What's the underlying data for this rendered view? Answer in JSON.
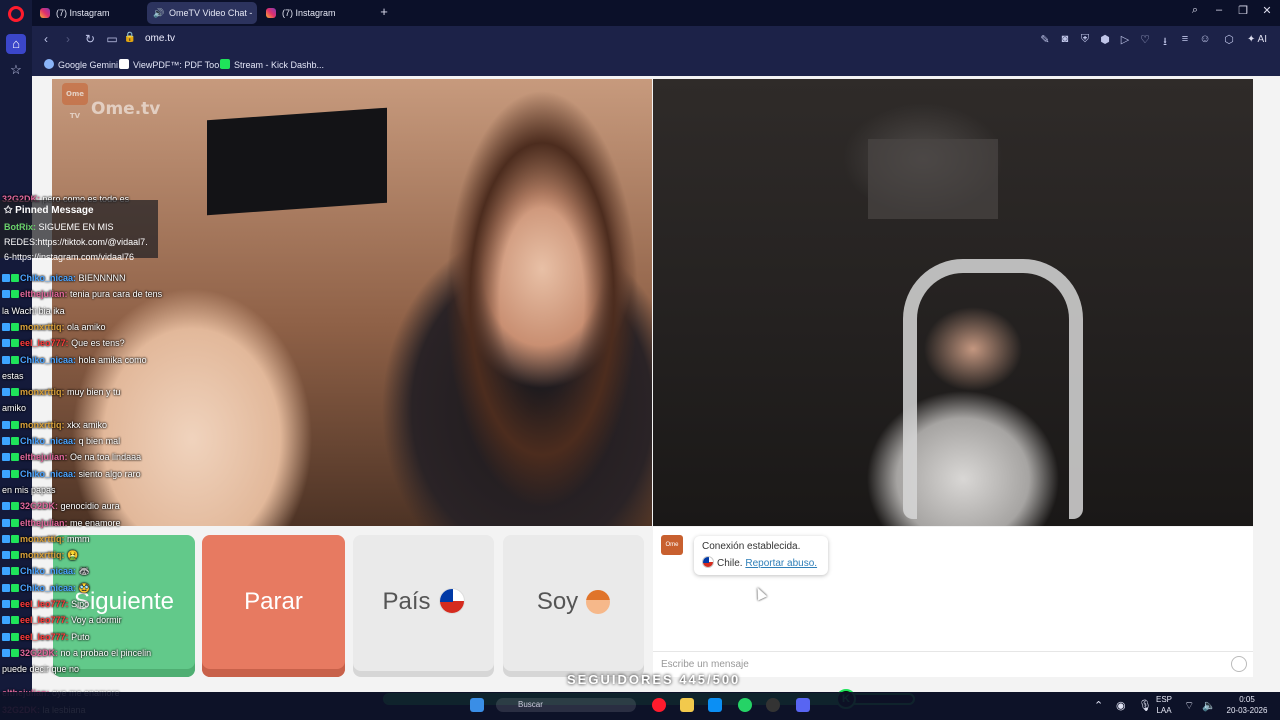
{
  "browser": {
    "tabs": [
      {
        "label": "(7) Instagram",
        "type": "instagram"
      },
      {
        "label": "OmeTV Video Chat -",
        "type": "speaker"
      },
      {
        "label": "(7) Instagram",
        "type": "instagram"
      }
    ],
    "url": "ome.tv",
    "bookmarks": [
      {
        "label": "Google Gemini",
        "color": "#8ab4f8"
      },
      {
        "label": "ViewPDF™: PDF Too...",
        "color": "#ffffff"
      },
      {
        "label": "Stream - Kick Dashb...",
        "color": "#1fe35a"
      }
    ],
    "ai_label": "AI"
  },
  "page": {
    "logo_text": "Ome.tv",
    "logo_icon_text": "Ome TV",
    "buttons": {
      "next": "Siguiente",
      "stop": "Parar",
      "country": "País",
      "gender": "Soy"
    },
    "chat": {
      "status": "Conexión establecida.",
      "country": "Chile.",
      "report": "Reportar abuso.",
      "placeholder": "Escribe un mensaje"
    }
  },
  "stream_overlay": {
    "pinned_title": "Pinned Message",
    "pinned_user": "BotRix:",
    "pinned_text_1": "SIGUEME EN MIS",
    "pinned_text_2": "REDES:https://tiktok.com/@vidaal7.",
    "pinned_text_3": "6-https://instagram.com/vidaal76",
    "top_line": {
      "user": "32G2DK:",
      "text": "pero como es todo es"
    },
    "messages": [
      {
        "user": "Chiko_nicaa:",
        "text": "BIENNNNN",
        "color": "#4aa3ff"
      },
      {
        "user": "elthejulian:",
        "text": "tenia pura cara de tens",
        "color": "#e0679b"
      },
      {
        "user": "",
        "text": "la Wachi bia ika",
        "color": "#ffffff"
      },
      {
        "user": "monxrttiq:",
        "text": "ola amiko",
        "color": "#d9a13a"
      },
      {
        "user": "eel_leo777:",
        "text": "Que es tens?",
        "color": "#ff3b3b"
      },
      {
        "user": "Chiko_nicaa:",
        "text": "hola amika como",
        "color": "#4aa3ff"
      },
      {
        "user": "",
        "text": "estas",
        "color": "#ffffff"
      },
      {
        "user": "monxrttiq:",
        "text": "muy bien y tu",
        "color": "#d9a13a"
      },
      {
        "user": "",
        "text": "amiko",
        "color": "#ffffff"
      },
      {
        "user": "monxrttiq:",
        "text": "xkx amiko",
        "color": "#d9a13a"
      },
      {
        "user": "Chiko_nicaa:",
        "text": "q bien mal",
        "color": "#4aa3ff"
      },
      {
        "user": "elthejulian:",
        "text": "Oe na toa lindaaa",
        "color": "#e0679b"
      },
      {
        "user": "Chiko_nicaa:",
        "text": "siento algo raro",
        "color": "#4aa3ff"
      },
      {
        "user": "",
        "text": "en mis papas",
        "color": "#ffffff"
      },
      {
        "user": "32G2DK:",
        "text": "genocidio aura",
        "color": "#e0679b"
      },
      {
        "user": "elthejulian:",
        "text": "me enamore",
        "color": "#e0679b"
      },
      {
        "user": "monxrttiq:",
        "text": "mmm",
        "color": "#d9a13a"
      },
      {
        "user": "monxrttiq:",
        "text": "🤮",
        "color": "#d9a13a"
      },
      {
        "user": "Chiko_nicaa:",
        "text": "🦝",
        "color": "#4aa3ff"
      },
      {
        "user": "Chiko_nicaa:",
        "text": "🥸",
        "color": "#4aa3ff"
      },
      {
        "user": "eel_leo777:",
        "text": "Sipo",
        "color": "#ff3b3b"
      },
      {
        "user": "eel_leo777:",
        "text": "Voy a dormir",
        "color": "#ff3b3b"
      },
      {
        "user": "eel_leo777:",
        "text": "Puto",
        "color": "#ff3b3b"
      },
      {
        "user": "32G2DK:",
        "text": "no a probao el pincelin",
        "color": "#e0679b"
      },
      {
        "user": "",
        "text": "puede decir que no",
        "color": "#ffffff"
      }
    ],
    "bottom_messages": [
      {
        "user": "elthejulian:",
        "text": "oye me enamore",
        "color": "#e0679b"
      },
      {
        "user": "32G2DK:",
        "text": "la lesbiana",
        "color": "#e0679b"
      }
    ],
    "followers_label": "SEGUIDORES 445/500",
    "followers_progress": 0.89
  },
  "taskbar": {
    "search_label": "Buscar",
    "lang_1": "ESP",
    "lang_2": "LAA",
    "time": "0:05",
    "date": "20-03-2026"
  }
}
